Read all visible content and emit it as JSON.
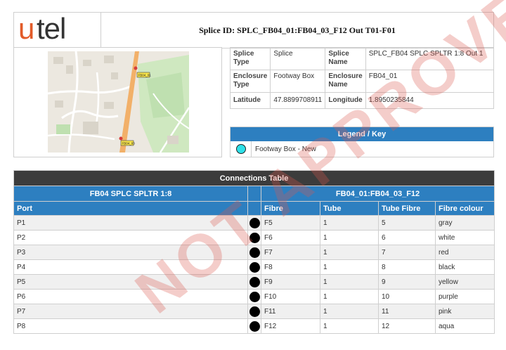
{
  "header": {
    "logo_text": "utel",
    "splice_id": "Splice ID: SPLC_FB04_01:FB04_03_F12 Out T01-F01"
  },
  "map": {
    "markers": [
      "FB04_01",
      "FB04_03"
    ]
  },
  "info": {
    "rows": [
      {
        "k1": "Splice Type",
        "v1": "Splice",
        "k2": "Splice Name",
        "v2": "SPLC_FB04 SPLC SPLTR 1:8 Out 1"
      },
      {
        "k1": "Enclosure Type",
        "v1": "Footway Box",
        "k2": "Enclosure Name",
        "v2": "FB04_01"
      },
      {
        "k1": "Latitude",
        "v1": "47.8899708911",
        "k2": "Longitude",
        "v2": "1.8950235844"
      }
    ]
  },
  "legend": {
    "title": "Legend / Key",
    "item_label": "Footway Box - New",
    "item_color": "#2de0e8"
  },
  "connections": {
    "title": "Connections Table",
    "left_group": "FB04 SPLC SPLTR 1:8",
    "right_group": "FB04_01:FB04_03_F12",
    "columns": [
      "Port",
      "Fibre",
      "Tube",
      "Tube Fibre",
      "Fibre colour"
    ],
    "rows": [
      [
        "P1",
        "F5",
        "1",
        "5",
        "gray"
      ],
      [
        "P2",
        "F6",
        "1",
        "6",
        "white"
      ],
      [
        "P3",
        "F7",
        "1",
        "7",
        "red"
      ],
      [
        "P4",
        "F8",
        "1",
        "8",
        "black"
      ],
      [
        "P5",
        "F9",
        "1",
        "9",
        "yellow"
      ],
      [
        "P6",
        "F10",
        "1",
        "10",
        "purple"
      ],
      [
        "P7",
        "F11",
        "1",
        "11",
        "pink"
      ],
      [
        "P8",
        "F12",
        "1",
        "12",
        "aqua"
      ]
    ]
  },
  "watermark": "NOT APPROVED"
}
